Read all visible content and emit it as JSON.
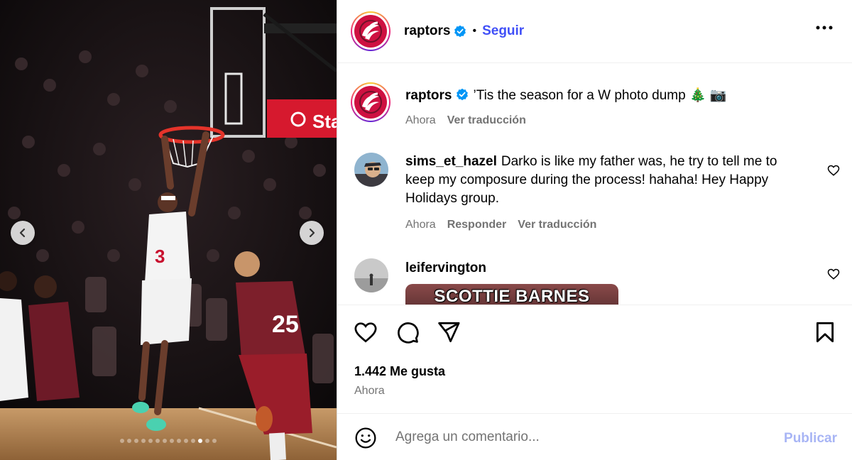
{
  "post": {
    "author": "raptors",
    "follow_label": "Seguir",
    "separator": "•",
    "caption": "’Tis the season for a W photo dump 🎄 📷",
    "caption_time": "Ahora",
    "translate_label": "Ver traducción",
    "likes": "1.442 Me gusta",
    "time": "Ahora"
  },
  "media": {
    "slide_count": 14,
    "active_slide": 12,
    "scoreboard_text": "Sta",
    "jersey_home": "25",
    "jersey_away": "3"
  },
  "comments": [
    {
      "user": "sims_et_hazel",
      "text": "Darko is like my father was, he try to tell me to keep my composure during the process! hahaha! Hey Happy Holidays group.",
      "time": "Ahora",
      "reply_label": "Responder",
      "translate_label": "Ver traducción"
    },
    {
      "user": "leifervington",
      "gif_text": "SCOTTIE BARNES OWNS"
    }
  ],
  "composer": {
    "placeholder": "Agrega un comentario...",
    "publish_label": "Publicar"
  },
  "colors": {
    "accent": "#0095f6",
    "follow": "#4150f7",
    "publish_disabled": "#a8b5f5",
    "raptors_red": "#ce1141"
  },
  "icons": [
    "chevron-left-icon",
    "chevron-right-icon",
    "more-icon",
    "verified-icon",
    "heart-icon",
    "comment-icon",
    "share-icon",
    "bookmark-icon",
    "emoji-icon"
  ]
}
